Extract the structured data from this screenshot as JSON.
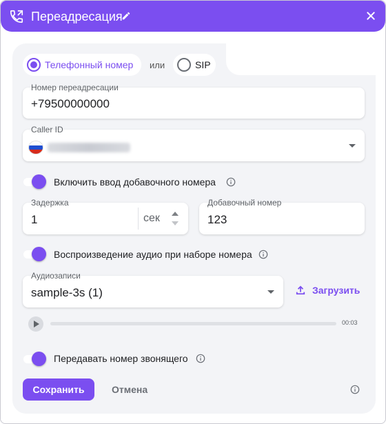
{
  "header": {
    "title": "Переадресация",
    "icon": "call-forward-icon",
    "edit_icon": "pencil-icon",
    "close_icon": "close-icon",
    "color": "#7b4ef0"
  },
  "destination_type": {
    "options": [
      {
        "label": "Телефонный номер",
        "selected": true
      },
      {
        "label": "SIP",
        "selected": false
      }
    ],
    "separator": "или"
  },
  "forward_number": {
    "label": "Номер переадресации",
    "value": "+79500000000"
  },
  "caller_id": {
    "label": "Caller ID",
    "flag": "russia-flag-icon"
  },
  "extension_toggle": {
    "label": "Включить ввод добавочного номера",
    "on": true
  },
  "delay": {
    "label": "Задержка",
    "value": "1",
    "unit": "сек"
  },
  "extension_number": {
    "label": "Добавочный номер",
    "value": "123"
  },
  "audio_toggle": {
    "label": "Воспроизведение аудио при наборе номера",
    "on": true
  },
  "audio_files": {
    "label": "Аудиозаписи",
    "value": "sample-3s (1)",
    "upload_label": "Загрузить"
  },
  "player": {
    "time": "00:03",
    "progress": 0
  },
  "pass_caller_toggle": {
    "label": "Передавать номер звонящего",
    "on": true
  },
  "actions": {
    "save": "Сохранить",
    "cancel": "Отмена"
  }
}
